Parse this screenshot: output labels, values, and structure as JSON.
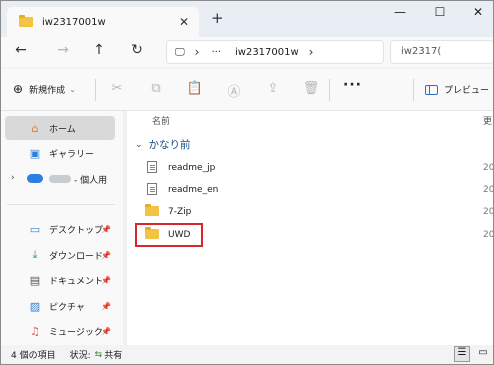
{
  "tab": {
    "title": "iw2317001w"
  },
  "address": {
    "crumb": "iw2317001w",
    "search_text": "iw2317("
  },
  "toolbar": {
    "new_label": "新規作成",
    "preview_label": "プレビュー"
  },
  "sidebar": {
    "home": "ホーム",
    "gallery": "ギャラリー",
    "onedrive": "- 個人用",
    "desktop": "デスクトップ",
    "downloads": "ダウンロード",
    "documents": "ドキュメント",
    "pictures": "ピクチャ",
    "music": "ミュージック"
  },
  "content": {
    "column_name": "名前",
    "column_date": "更",
    "group": "かなり前",
    "files": [
      {
        "name": "readme_jp",
        "type": "document",
        "date": "20"
      },
      {
        "name": "readme_en",
        "type": "document",
        "date": "20"
      },
      {
        "name": "7-Zip",
        "type": "folder",
        "date": "20"
      },
      {
        "name": "UWD",
        "type": "folder",
        "date": "20"
      }
    ]
  },
  "status": {
    "count": "4 個の項目",
    "state_label": "状況:",
    "state_value": "共有"
  },
  "colors": {
    "highlight": "#d8262d",
    "folder": "#f3c443",
    "accent": "#2f6fbf"
  }
}
